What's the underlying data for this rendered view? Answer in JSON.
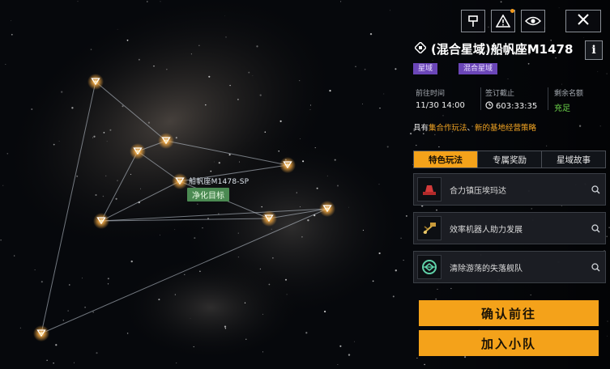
{
  "toolbar": {
    "buttons": [
      {
        "icon": "flag-icon"
      },
      {
        "icon": "warning-triangle-icon",
        "has_alert_dot": true
      },
      {
        "icon": "eye-icon"
      }
    ],
    "close_icon": "close-x-icon"
  },
  "starmap": {
    "focus_node_label": "船帆座M1478-SP",
    "focus_node_tag": "净化目标"
  },
  "panel": {
    "title": "(混合星域)船帆座M1478",
    "title_icon": "sector-diamond-icon",
    "info_label": "i",
    "tags": [
      "星域",
      "混合星域"
    ],
    "stats": [
      {
        "label": "前往时间",
        "value": "11/30 14:00"
      },
      {
        "label": "签订截止",
        "value": "603:33:35",
        "icon": "clock-icon"
      },
      {
        "label": "剩余名额",
        "value": "充足",
        "color": "#6cd34a"
      }
    ],
    "feature_prefix": "具有",
    "feature_part1": "集合作玩法",
    "feature_sep": "、",
    "feature_part2": "新的基地经营策略",
    "tabs": [
      {
        "label": "特色玩法",
        "active": true
      },
      {
        "label": "专属奖励",
        "active": false
      },
      {
        "label": "星域故事",
        "active": false
      }
    ],
    "features": [
      {
        "label": "合力镇压埃玛达",
        "icon": "red-alarm-icon"
      },
      {
        "label": "效率机器人助力发展",
        "icon": "robot-icon"
      },
      {
        "label": "清除游荡的失落舰队",
        "icon": "fleet-target-icon"
      }
    ],
    "actions": {
      "confirm_label": "确认前往",
      "join_label": "加入小队"
    }
  },
  "colors": {
    "accent": "#f4a21a",
    "tag_purple": "#6b46b8",
    "ok_green": "#6cd34a",
    "target_green": "#4b8a52"
  }
}
